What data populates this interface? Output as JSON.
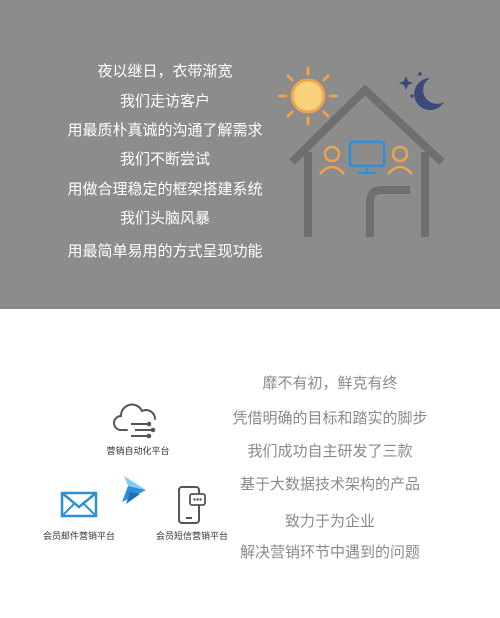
{
  "top_section": {
    "lines": [
      "夜以继日，衣带渐宽",
      "我们走访客户",
      "用最质朴真诚的沟通了解需求",
      "我们不断尝试",
      "用做合理稳定的框架搭建系统",
      "我们头脑风暴",
      "用最简单易用的方式呈现功能"
    ]
  },
  "bottom_section": {
    "lines": [
      "靡不有初，鲜克有终",
      "凭借明确的目标和踏实的脚步",
      "我们成功自主研发了三款",
      "基于大数据技术架构的产品",
      "致力于为企业",
      "解决营销环节中遇到的问题"
    ],
    "platforms": [
      {
        "label": "营销自动化平台",
        "icon": "cloud-share-icon"
      },
      {
        "label": "会员邮件营销平台",
        "icon": "envelope-icon"
      },
      {
        "label": "会员短信营销平台",
        "icon": "phone-chat-icon"
      }
    ],
    "center_icon": "paper-plane-icon"
  },
  "colors": {
    "top_bg": "#8c8c8c",
    "accent_orange": "#f0a24e",
    "accent_blue": "#2f8fd6",
    "moon": "#3b4a7a"
  }
}
